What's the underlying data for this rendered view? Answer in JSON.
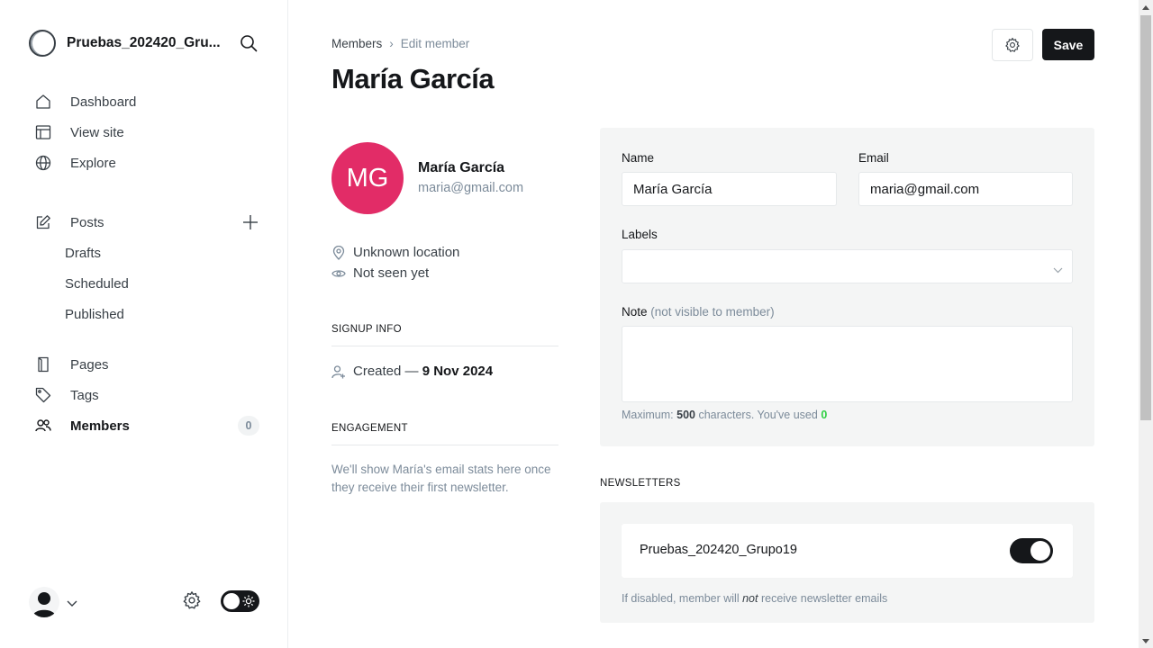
{
  "sidebar": {
    "site_title": "Pruebas_202420_Gru...",
    "nav": {
      "dashboard": "Dashboard",
      "view_site": "View site",
      "explore": "Explore",
      "posts": "Posts",
      "drafts": "Drafts",
      "scheduled": "Scheduled",
      "published": "Published",
      "pages": "Pages",
      "tags": "Tags",
      "members": "Members",
      "members_count": "0"
    }
  },
  "header": {
    "breadcrumb": {
      "parent": "Members",
      "separator": "›",
      "current": "Edit member"
    },
    "title": "María García",
    "save_label": "Save"
  },
  "member": {
    "initials": "MG",
    "name": "María García",
    "email": "maria@gmail.com",
    "avatar_color": "#e22c67",
    "location": "Unknown location",
    "last_seen": "Not seen yet",
    "signup_heading": "SIGNUP INFO",
    "created_prefix": "Created —",
    "created_date": "9 Nov 2024",
    "engagement_heading": "ENGAGEMENT",
    "engagement_text": "We'll show María's email stats here once they receive their first newsletter."
  },
  "form": {
    "name_label": "Name",
    "name_value": "María García",
    "email_label": "Email",
    "email_value": "maria@gmail.com",
    "labels_label": "Labels",
    "note_label": "Note",
    "note_hint": "(not visible to member)",
    "note_value": "",
    "max_prefix": "Maximum:",
    "max_value": "500",
    "max_mid": "characters. You've used",
    "used_value": "0"
  },
  "newsletters": {
    "heading": "NEWSLETTERS",
    "items": [
      {
        "name": "Pruebas_202420_Grupo19",
        "enabled": true
      }
    ],
    "hint_before": "If disabled, member will",
    "hint_em": "not",
    "hint_after": "receive newsletter emails"
  }
}
